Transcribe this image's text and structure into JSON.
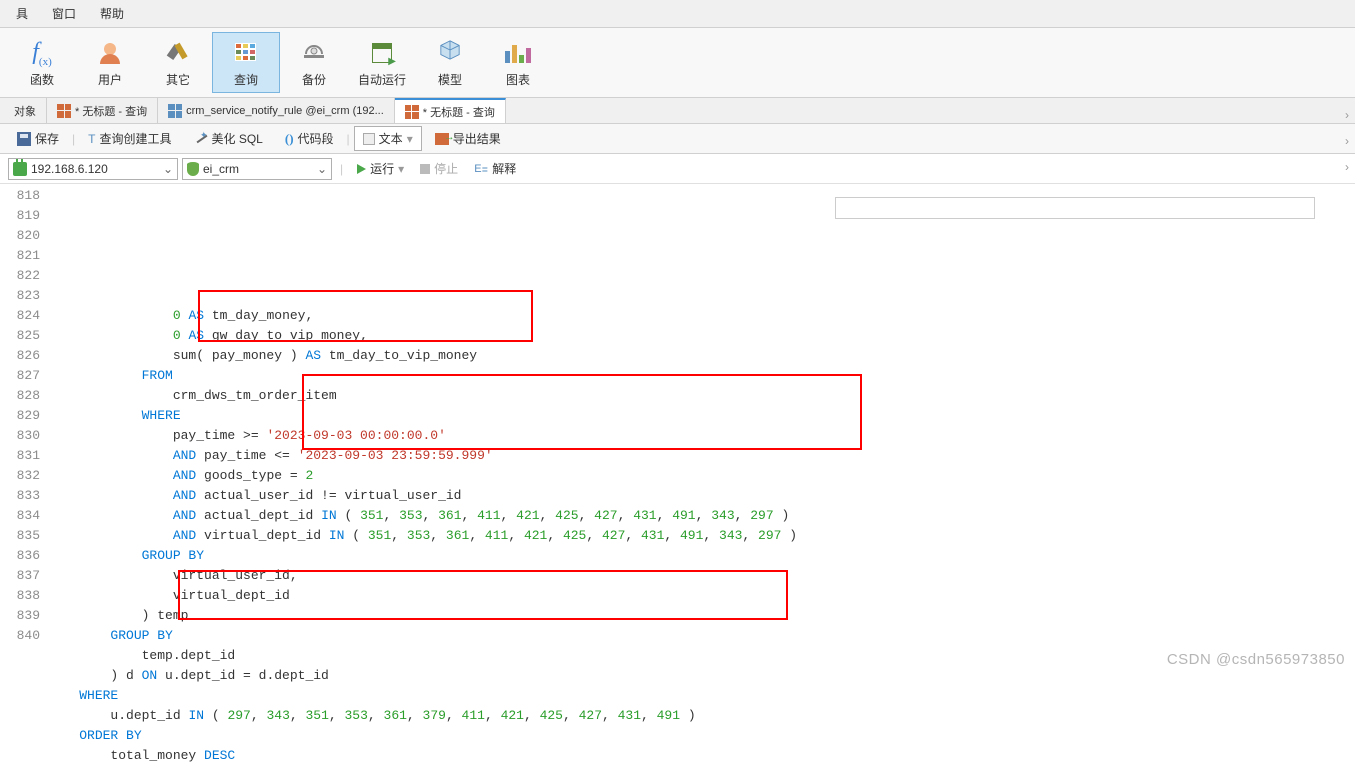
{
  "menubar": {
    "items": [
      "具",
      "窗口",
      "帮助"
    ]
  },
  "toolbar": {
    "items": [
      {
        "label": "函数",
        "name": "function-tool"
      },
      {
        "label": "用户",
        "name": "user-tool"
      },
      {
        "label": "其它",
        "name": "other-tool"
      },
      {
        "label": "查询",
        "name": "query-tool",
        "active": true
      },
      {
        "label": "备份",
        "name": "backup-tool"
      },
      {
        "label": "自动运行",
        "name": "autorun-tool"
      },
      {
        "label": "模型",
        "name": "model-tool"
      },
      {
        "label": "图表",
        "name": "chart-tool"
      }
    ]
  },
  "tabbar": {
    "tabs": [
      {
        "label": "对象",
        "name": "tab-objects"
      },
      {
        "label": "* 无标题 - 查询",
        "name": "tab-untitled-1"
      },
      {
        "label": "crm_service_notify_rule @ei_crm (192...",
        "name": "tab-crm-service"
      },
      {
        "label": "* 无标题 - 查询",
        "name": "tab-untitled-2",
        "active": true
      }
    ]
  },
  "subtoolbar": {
    "save": "保存",
    "query_builder": "查询创建工具",
    "beautify": "美化 SQL",
    "snippet": "代码段",
    "text": "文本",
    "export": "导出结果"
  },
  "connbar": {
    "host": "192.168.6.120",
    "db": "ei_crm",
    "run": "运行",
    "stop": "停止",
    "explain": "解释"
  },
  "code": {
    "lines": [
      {
        "n": 818,
        "i": 4,
        "t": [
          {
            "c": "num",
            "v": "0"
          },
          {
            "c": "",
            "v": " "
          },
          {
            "c": "kw",
            "v": "AS"
          },
          {
            "c": "",
            "v": " tm_day_money,"
          }
        ]
      },
      {
        "n": 819,
        "i": 4,
        "t": [
          {
            "c": "num",
            "v": "0"
          },
          {
            "c": "",
            "v": " "
          },
          {
            "c": "kw",
            "v": "AS"
          },
          {
            "c": "",
            "v": " gw_day_to_vip_money,"
          }
        ]
      },
      {
        "n": 820,
        "i": 4,
        "t": [
          {
            "c": "",
            "v": "sum( pay_money ) "
          },
          {
            "c": "kw",
            "v": "AS"
          },
          {
            "c": "",
            "v": " tm_day_to_vip_money "
          }
        ]
      },
      {
        "n": 821,
        "i": 3,
        "t": [
          {
            "c": "kw",
            "v": "FROM"
          }
        ]
      },
      {
        "n": 822,
        "i": 4,
        "t": [
          {
            "c": "",
            "v": "crm_dws_tm_order_item "
          }
        ]
      },
      {
        "n": 823,
        "i": 3,
        "t": [
          {
            "c": "kw",
            "v": "WHERE"
          }
        ]
      },
      {
        "n": 824,
        "i": 4,
        "t": [
          {
            "c": "",
            "v": "pay_time >= "
          },
          {
            "c": "str",
            "v": "'2023-09-03 00:00:00.0'"
          },
          {
            "c": "",
            "v": " "
          }
        ]
      },
      {
        "n": 825,
        "i": 4,
        "t": [
          {
            "c": "kw",
            "v": "AND"
          },
          {
            "c": "",
            "v": " pay_time <= "
          },
          {
            "c": "str",
            "v": "'2023-09-03 23:59:59.999'"
          },
          {
            "c": "",
            "v": " "
          }
        ]
      },
      {
        "n": 826,
        "i": 4,
        "t": [
          {
            "c": "kw",
            "v": "AND"
          },
          {
            "c": "",
            "v": " goods_type = "
          },
          {
            "c": "num",
            "v": "2"
          },
          {
            "c": "",
            "v": " "
          }
        ]
      },
      {
        "n": 827,
        "i": 4,
        "t": [
          {
            "c": "kw",
            "v": "AND"
          },
          {
            "c": "",
            "v": " actual_user_id != virtual_user_id "
          }
        ]
      },
      {
        "n": 828,
        "i": 4,
        "t": [
          {
            "c": "kw",
            "v": "AND"
          },
          {
            "c": "",
            "v": " actual_dept_id "
          },
          {
            "c": "kw",
            "v": "IN"
          },
          {
            "c": "",
            "v": " ( "
          },
          {
            "c": "num",
            "v": "351"
          },
          {
            "c": "",
            "v": ", "
          },
          {
            "c": "num",
            "v": "353"
          },
          {
            "c": "",
            "v": ", "
          },
          {
            "c": "num",
            "v": "361"
          },
          {
            "c": "",
            "v": ", "
          },
          {
            "c": "num",
            "v": "411"
          },
          {
            "c": "",
            "v": ", "
          },
          {
            "c": "num",
            "v": "421"
          },
          {
            "c": "",
            "v": ", "
          },
          {
            "c": "num",
            "v": "425"
          },
          {
            "c": "",
            "v": ", "
          },
          {
            "c": "num",
            "v": "427"
          },
          {
            "c": "",
            "v": ", "
          },
          {
            "c": "num",
            "v": "431"
          },
          {
            "c": "",
            "v": ", "
          },
          {
            "c": "num",
            "v": "491"
          },
          {
            "c": "",
            "v": ", "
          },
          {
            "c": "num",
            "v": "343"
          },
          {
            "c": "",
            "v": ", "
          },
          {
            "c": "num",
            "v": "297"
          },
          {
            "c": "",
            "v": " ) "
          }
        ]
      },
      {
        "n": 829,
        "i": 4,
        "t": [
          {
            "c": "kw",
            "v": "AND"
          },
          {
            "c": "",
            "v": " virtual_dept_id "
          },
          {
            "c": "kw",
            "v": "IN"
          },
          {
            "c": "",
            "v": " ( "
          },
          {
            "c": "num",
            "v": "351"
          },
          {
            "c": "",
            "v": ", "
          },
          {
            "c": "num",
            "v": "353"
          },
          {
            "c": "",
            "v": ", "
          },
          {
            "c": "num",
            "v": "361"
          },
          {
            "c": "",
            "v": ", "
          },
          {
            "c": "num",
            "v": "411"
          },
          {
            "c": "",
            "v": ", "
          },
          {
            "c": "num",
            "v": "421"
          },
          {
            "c": "",
            "v": ", "
          },
          {
            "c": "num",
            "v": "425"
          },
          {
            "c": "",
            "v": ", "
          },
          {
            "c": "num",
            "v": "427"
          },
          {
            "c": "",
            "v": ", "
          },
          {
            "c": "num",
            "v": "431"
          },
          {
            "c": "",
            "v": ", "
          },
          {
            "c": "num",
            "v": "491"
          },
          {
            "c": "",
            "v": ", "
          },
          {
            "c": "num",
            "v": "343"
          },
          {
            "c": "",
            "v": ", "
          },
          {
            "c": "num",
            "v": "297"
          },
          {
            "c": "",
            "v": " ) "
          }
        ]
      },
      {
        "n": 830,
        "i": 3,
        "t": [
          {
            "c": "kw",
            "v": "GROUP BY"
          }
        ]
      },
      {
        "n": 831,
        "i": 4,
        "t": [
          {
            "c": "",
            "v": "virtual_user_id,"
          }
        ]
      },
      {
        "n": 832,
        "i": 4,
        "t": [
          {
            "c": "",
            "v": "virtual_dept_id "
          }
        ]
      },
      {
        "n": 833,
        "i": 3,
        "t": [
          {
            "c": "",
            "v": ") temp "
          }
        ]
      },
      {
        "n": 834,
        "i": 2,
        "t": [
          {
            "c": "kw",
            "v": "GROUP BY"
          }
        ]
      },
      {
        "n": 835,
        "i": 3,
        "t": [
          {
            "c": "",
            "v": "temp.dept_id "
          }
        ]
      },
      {
        "n": 836,
        "i": 2,
        "t": [
          {
            "c": "",
            "v": ") d "
          },
          {
            "c": "kw",
            "v": "ON"
          },
          {
            "c": "",
            "v": " u.dept_id = d.dept_id "
          }
        ]
      },
      {
        "n": 837,
        "i": 1,
        "t": [
          {
            "c": "kw",
            "v": "WHERE"
          }
        ]
      },
      {
        "n": 838,
        "i": 2,
        "t": [
          {
            "c": "",
            "v": "u.dept_id "
          },
          {
            "c": "kw",
            "v": "IN"
          },
          {
            "c": "",
            "v": " ( "
          },
          {
            "c": "num",
            "v": "297"
          },
          {
            "c": "",
            "v": ", "
          },
          {
            "c": "num",
            "v": "343"
          },
          {
            "c": "",
            "v": ", "
          },
          {
            "c": "num",
            "v": "351"
          },
          {
            "c": "",
            "v": ", "
          },
          {
            "c": "num",
            "v": "353"
          },
          {
            "c": "",
            "v": ", "
          },
          {
            "c": "num",
            "v": "361"
          },
          {
            "c": "",
            "v": ", "
          },
          {
            "c": "num",
            "v": "379"
          },
          {
            "c": "",
            "v": ", "
          },
          {
            "c": "num",
            "v": "411"
          },
          {
            "c": "",
            "v": ", "
          },
          {
            "c": "num",
            "v": "421"
          },
          {
            "c": "",
            "v": ", "
          },
          {
            "c": "num",
            "v": "425"
          },
          {
            "c": "",
            "v": ", "
          },
          {
            "c": "num",
            "v": "427"
          },
          {
            "c": "",
            "v": ", "
          },
          {
            "c": "num",
            "v": "431"
          },
          {
            "c": "",
            "v": ", "
          },
          {
            "c": "num",
            "v": "491"
          },
          {
            "c": "",
            "v": " ) "
          }
        ]
      },
      {
        "n": 839,
        "i": 1,
        "t": [
          {
            "c": "kw",
            "v": "ORDER BY"
          }
        ]
      },
      {
        "n": 840,
        "i": 2,
        "t": [
          {
            "c": "",
            "v": "total_money "
          },
          {
            "c": "kw",
            "v": "DESC"
          }
        ]
      }
    ]
  },
  "watermark": "CSDN @csdn565973850"
}
